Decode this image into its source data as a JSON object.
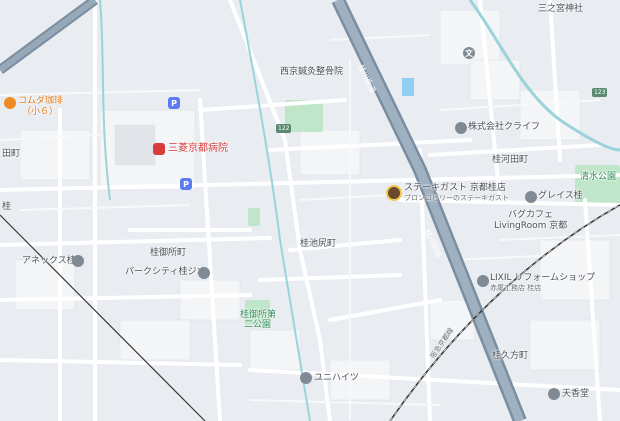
{
  "map": {
    "labels": {
      "sannomiya_jinja": "三之宮神社",
      "seikotsuin": "西京鍼灸整骨院",
      "hospital": "三菱京都病院",
      "komeda": "コムダ珈琲",
      "komeda_sub": "（小６）",
      "klaif": "株式会社クライフ",
      "katsura_kawada": "桂河田町",
      "steak_gust": "ステーキガスト 京都桂店",
      "steak_gust_sub": "ブロンコビリーのステーキガスト",
      "grace": "グレイス桂",
      "shimizu_park": "清水公園",
      "bagcafe": "バグカフェ",
      "livingroom": "LivingRoom 京都",
      "katsura_goshocho": "桂御所町",
      "katsura_ikejiricho": "桂池尻町",
      "annex": "アネックス桂",
      "parkcity": "パークシティ桂ジオ",
      "goshocho_park_1": "桂御所第",
      "goshocho_park_2": "二公園",
      "lixil": "LIXIL リフォームショップ",
      "lixil_sub": "赤尾工務店 桂店",
      "katsura_oikatacho": "桂久方町",
      "unihights": "ユニハイツ",
      "tenpoudo": "天香堂",
      "tadacho": "田町",
      "katsura_label": "桂",
      "bun": "文",
      "road_shield_122": "122",
      "road_shield_123": "123"
    },
    "roads": {
      "katsura_kaido": "桂川街道",
      "katsura_kaido_2": "桂川街道",
      "hankyu": "阪急京都線"
    },
    "icons": {
      "parking": "P"
    }
  }
}
